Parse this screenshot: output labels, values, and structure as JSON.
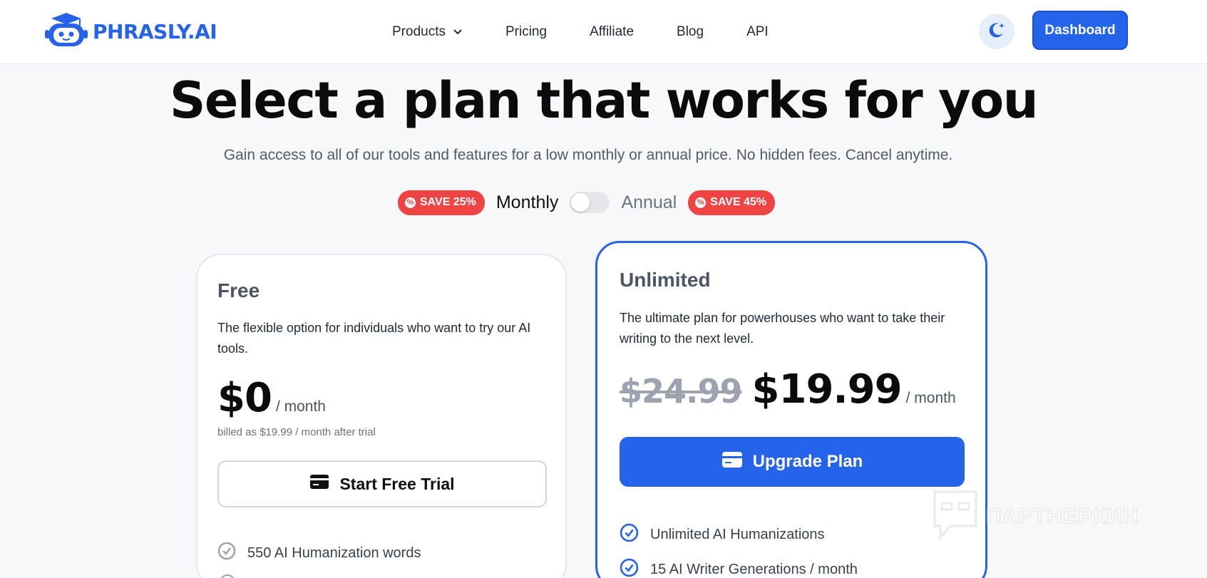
{
  "header": {
    "logo_text": "PHRASLY.AI",
    "nav": [
      {
        "label": "Products",
        "has_dropdown": true
      },
      {
        "label": "Pricing"
      },
      {
        "label": "Affiliate"
      },
      {
        "label": "Blog"
      },
      {
        "label": "API"
      }
    ],
    "theme_icon": "moon-icon",
    "dashboard_label": "Dashboard",
    "accent_color": "#2563eb"
  },
  "hero": {
    "title": "Select a plan that works for you",
    "subtitle": "Gain access to all of our tools and features for a low monthly or annual price. No hidden fees. Cancel anytime."
  },
  "billing_toggle": {
    "save_monthly": "SAVE 25%",
    "monthly_label": "Monthly",
    "annual_label": "Annual",
    "save_annual": "SAVE 45%",
    "selected": "Monthly",
    "badge_color": "#ef4444"
  },
  "plans": [
    {
      "name": "Free",
      "description": "The flexible option for individuals who want to try our AI tools.",
      "price": "$0",
      "period": "/ month",
      "billed_note": "billed as $19.99 / month after trial",
      "cta": "Start Free Trial",
      "features": [
        "550 AI Humanization words"
      ]
    },
    {
      "name": "Unlimited",
      "description": "The ultimate plan for powerhouses who want to take their writing to the next level.",
      "old_price": "$24.99",
      "price": "$19.99",
      "period": "/ month",
      "cta": "Upgrade Plan",
      "features": [
        "Unlimited AI Humanizations",
        "15 AI Writer Generations / month"
      ],
      "highlighted": true
    }
  ],
  "watermark": {
    "text": "ПАРТНЕРКИН"
  }
}
